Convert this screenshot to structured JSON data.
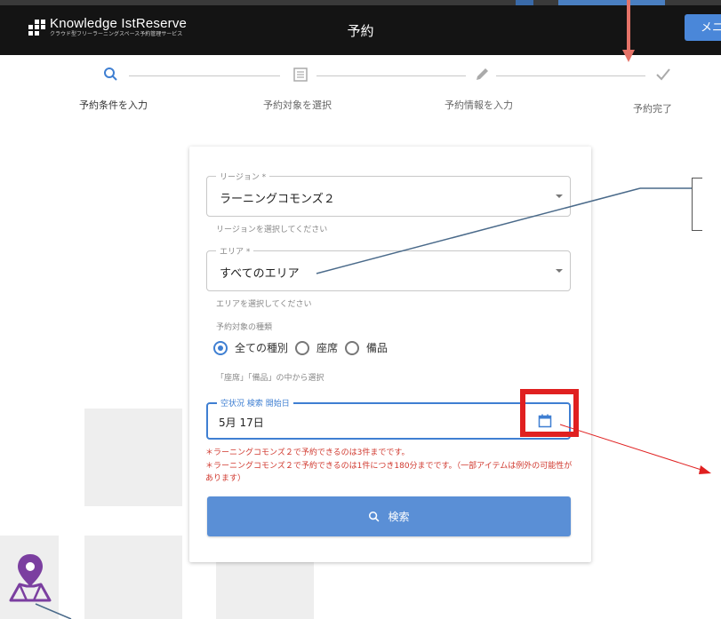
{
  "header": {
    "logo_title": "Knowledge IstReserve",
    "logo_subtitle": "クラウド型フリーラーニングスペース予約管理サービス",
    "page_title": "予約",
    "menu_label": "メニ"
  },
  "stepper": {
    "steps": [
      {
        "label": "予約条件を入力",
        "icon": "search-icon",
        "active": true
      },
      {
        "label": "予約対象を選択",
        "icon": "list-icon",
        "active": false
      },
      {
        "label": "予約情報を入力",
        "icon": "pencil-icon",
        "active": false
      },
      {
        "label": "予約完了",
        "icon": "check-icon",
        "active": false
      }
    ]
  },
  "form": {
    "region": {
      "legend": "リージョン *",
      "value": "ラーニングコモンズ２",
      "helper": "リージョンを選択してください"
    },
    "area": {
      "legend": "エリア *",
      "value": "すべてのエリア",
      "helper": "エリアを選択してください"
    },
    "target_type": {
      "legend": "予約対象の種類",
      "options": [
        {
          "label": "全ての種別",
          "checked": true
        },
        {
          "label": "座席",
          "checked": false
        },
        {
          "label": "備品",
          "checked": false
        }
      ],
      "helper": "「座席」「備品」の中から選択"
    },
    "date": {
      "legend": "空状況 検索 開始日",
      "value": "5月 17日"
    },
    "notes": [
      "＊ラーニングコモンズ２で予約できるのは3件までです。",
      "＊ラーニングコモンズ２で予約できるのは1件につき180分までです。（一部アイテムは例外の可能性があります）"
    ],
    "search_label": "検索"
  },
  "colors": {
    "header_bg": "#141414",
    "accent": "#3f7fd2",
    "button": "#5a8fd6",
    "note_red": "#d0382e",
    "highlight_red": "#e02020",
    "annotation_arrow": "#e57368",
    "map_pin": "#7b3fa0"
  }
}
